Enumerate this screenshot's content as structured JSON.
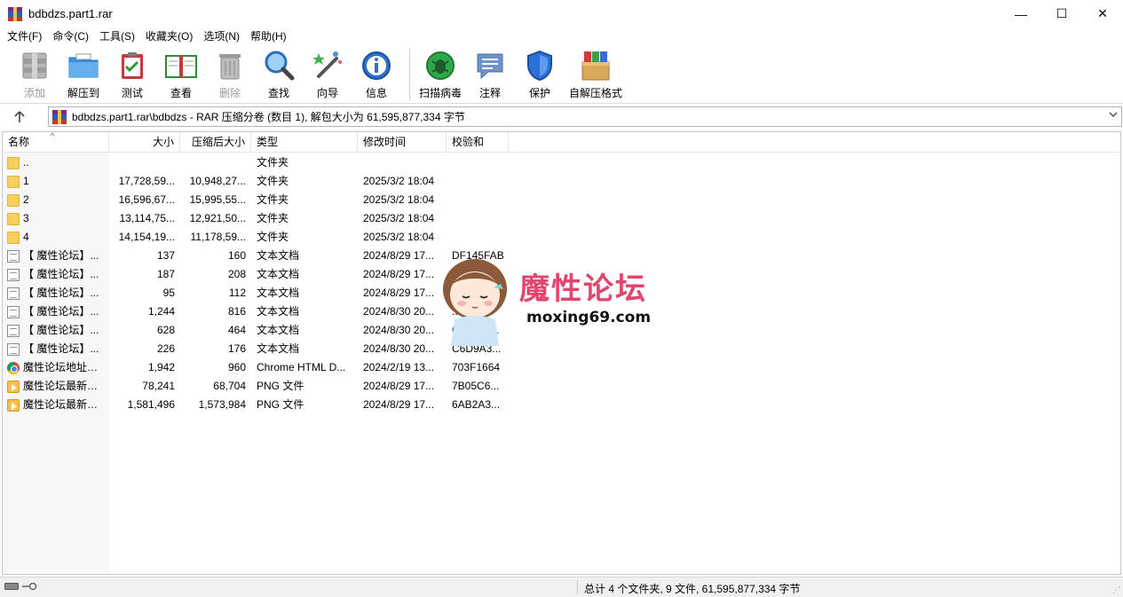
{
  "window": {
    "title": "bdbdzs.part1.rar",
    "minimize": "—",
    "maximize": "☐",
    "close": "✕"
  },
  "menu": [
    "文件(F)",
    "命令(C)",
    "工具(S)",
    "收藏夹(O)",
    "选项(N)",
    "帮助(H)"
  ],
  "toolbar": {
    "add": "添加",
    "extract_to": "解压到",
    "test": "测试",
    "view": "查看",
    "delete": "删除",
    "find": "查找",
    "wizard": "向导",
    "info": "信息",
    "scan": "扫描病毒",
    "comment": "注释",
    "protect": "保护",
    "sfx": "自解压格式"
  },
  "address": {
    "path": "bdbdzs.part1.rar\\bdbdzs - RAR 压缩分卷 (数目 1), 解包大小为 61,595,877,334 字节"
  },
  "columns": {
    "name": "名称",
    "size": "大小",
    "packed": "压缩后大小",
    "type": "类型",
    "modified": "修改时间",
    "crc": "校验和"
  },
  "files": [
    {
      "icon": "folder",
      "name": "..",
      "size": "",
      "packed": "",
      "type": "文件夹",
      "modified": "",
      "crc": ""
    },
    {
      "icon": "folder",
      "name": "1",
      "size": "17,728,59...",
      "packed": "10,948,27...",
      "type": "文件夹",
      "modified": "2025/3/2 18:04",
      "crc": ""
    },
    {
      "icon": "folder",
      "name": "2",
      "size": "16,596,67...",
      "packed": "15,995,55...",
      "type": "文件夹",
      "modified": "2025/3/2 18:04",
      "crc": ""
    },
    {
      "icon": "folder",
      "name": "3",
      "size": "13,114,75...",
      "packed": "12,921,50...",
      "type": "文件夹",
      "modified": "2025/3/2 18:04",
      "crc": ""
    },
    {
      "icon": "folder",
      "name": "4",
      "size": "14,154,19...",
      "packed": "11,178,59...",
      "type": "文件夹",
      "modified": "2025/3/2 18:04",
      "crc": ""
    },
    {
      "icon": "text",
      "name": "【 魔性论坛】...",
      "size": "137",
      "packed": "160",
      "type": "文本文档",
      "modified": "2024/8/29 17...",
      "crc": "DF145FAB"
    },
    {
      "icon": "text",
      "name": "【 魔性论坛】...",
      "size": "187",
      "packed": "208",
      "type": "文本文档",
      "modified": "2024/8/29 17...",
      "crc": "...1"
    },
    {
      "icon": "text",
      "name": "【 魔性论坛】...",
      "size": "95",
      "packed": "112",
      "type": "文本文档",
      "modified": "2024/8/29 17...",
      "crc": ""
    },
    {
      "icon": "text",
      "name": "【 魔性论坛】...",
      "size": "1,244",
      "packed": "816",
      "type": "文本文档",
      "modified": "2024/8/30 20...",
      "crc": "...0AE6"
    },
    {
      "icon": "text",
      "name": "【 魔性论坛】...",
      "size": "628",
      "packed": "464",
      "type": "文本文档",
      "modified": "2024/8/30 20...",
      "crc": "C...892F1"
    },
    {
      "icon": "text",
      "name": "【 魔性论坛】...",
      "size": "226",
      "packed": "176",
      "type": "文本文档",
      "modified": "2024/8/30 20...",
      "crc": "C6D9A3..."
    },
    {
      "icon": "chrome",
      "name": "魔性论坛地址发...",
      "size": "1,942",
      "packed": "960",
      "type": "Chrome HTML D...",
      "modified": "2024/2/19 13...",
      "crc": "703F1664"
    },
    {
      "icon": "png",
      "name": "魔性论坛最新开...",
      "size": "78,241",
      "packed": "68,704",
      "type": "PNG 文件",
      "modified": "2024/8/29 17...",
      "crc": "7B05C6..."
    },
    {
      "icon": "png",
      "name": "魔性论坛最新开...",
      "size": "1,581,496",
      "packed": "1,573,984",
      "type": "PNG 文件",
      "modified": "2024/8/29 17...",
      "crc": "6AB2A3..."
    }
  ],
  "watermark": {
    "title": "魔性论坛",
    "url": "moxing69.com"
  },
  "status": {
    "summary": "总计 4 个文件夹, 9 文件, 61,595,877,334 字节"
  },
  "colors": {
    "watermark_pink": "#e0476e",
    "folder_yellow": "#f6cf5c"
  }
}
